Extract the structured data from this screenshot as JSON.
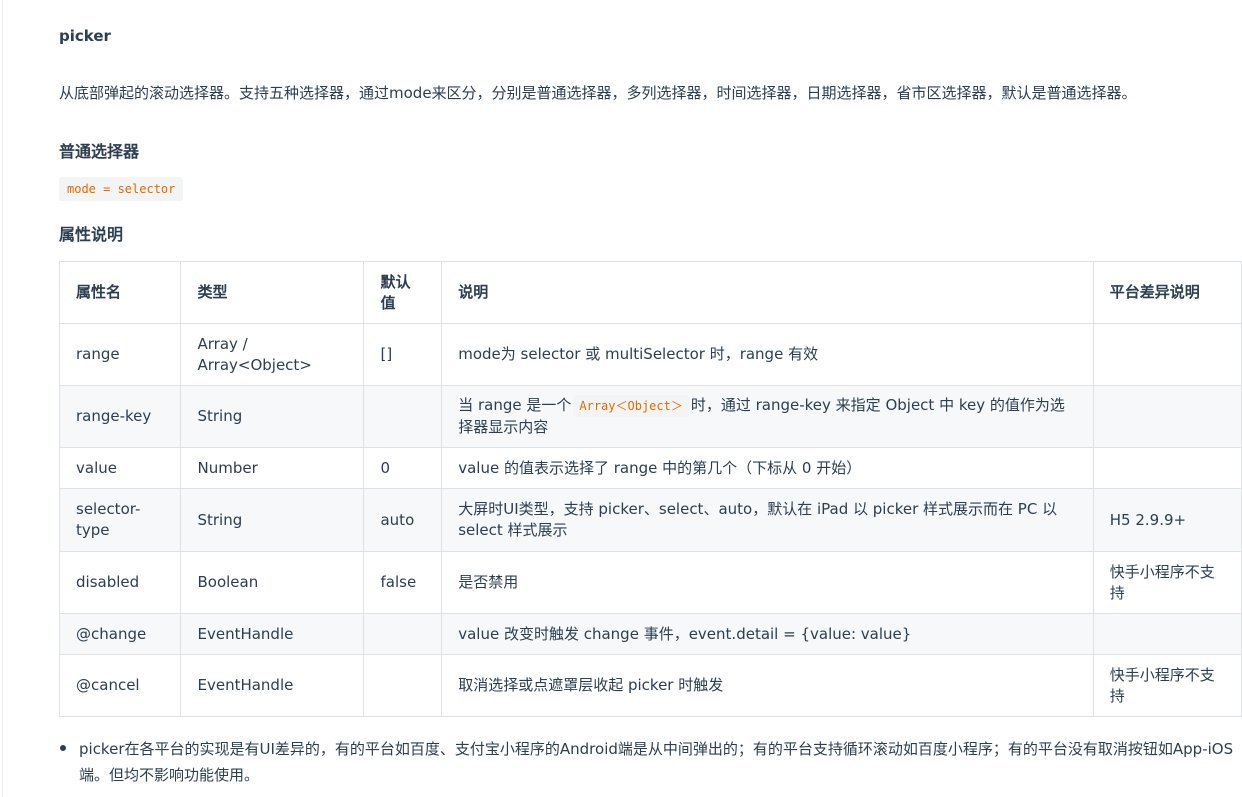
{
  "doc": {
    "title": "picker",
    "intro": "从底部弹起的滚动选择器。支持五种选择器，通过mode来区分，分别是普通选择器，多列选择器，时间选择器，日期选择器，省市区选择器，默认是普通选择器。",
    "section_normal": "普通选择器",
    "mode_code": "mode = selector",
    "section_props": "属性说明"
  },
  "table": {
    "headers": [
      "属性名",
      "类型",
      "默认值",
      "说明",
      "平台差异说明"
    ],
    "rows": [
      {
        "name": "range",
        "type": "Array / Array<Object>",
        "default": "[]",
        "desc": "mode为 selector 或 multiSelector 时，range 有效",
        "platform": ""
      },
      {
        "name": "range-key",
        "type": "String",
        "default": "",
        "desc_before": "当 range 是一个",
        "desc_code": "Array＜Object＞",
        "desc_after": "时，通过 range-key 来指定 Object 中 key 的值作为选择器显示内容",
        "platform": ""
      },
      {
        "name": "value",
        "type": "Number",
        "default": "0",
        "desc": "value 的值表示选择了 range 中的第几个（下标从 0 开始）",
        "platform": ""
      },
      {
        "name": "selector-type",
        "type": "String",
        "default": "auto",
        "desc": "大屏时UI类型，支持 picker、select、auto，默认在 iPad 以 picker 样式展示而在 PC 以 select 样式展示",
        "platform": "H5 2.9.9+"
      },
      {
        "name": "disabled",
        "type": "Boolean",
        "default": "false",
        "desc": "是否禁用",
        "platform": "快手小程序不支持"
      },
      {
        "name": "@change",
        "type": "EventHandle",
        "default": "",
        "desc": "value 改变时触发 change 事件，event.detail = {value: value}",
        "platform": ""
      },
      {
        "name": "@cancel",
        "type": "EventHandle",
        "default": "",
        "desc": "取消选择或点遮罩层收起 picker 时触发",
        "platform": "快手小程序不支持"
      }
    ]
  },
  "notes": [
    "picker在各平台的实现是有UI差异的，有的平台如百度、支付宝小程序的Android端是从中间弹出的；有的平台支持循环滚动如百度小程序；有的平台没有取消按钮如App-iOS端。但均不影响功能使用。"
  ]
}
